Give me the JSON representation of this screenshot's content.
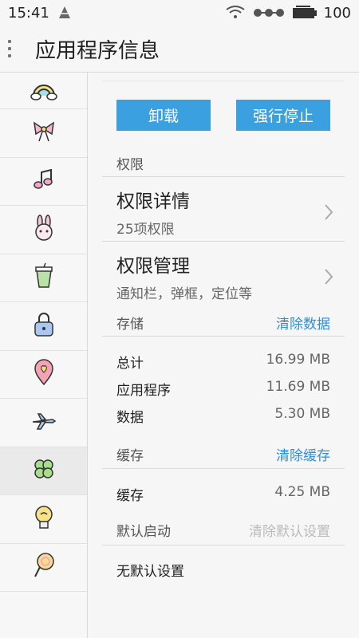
{
  "status_bar": {
    "time": "15:41",
    "battery": "100"
  },
  "header": {
    "title": "应用程序信息"
  },
  "sidebar": {
    "icons": [
      "rainbow-icon",
      "bow-icon",
      "music-note-icon",
      "bunny-icon",
      "cup-icon",
      "lock-icon",
      "location-pin-icon",
      "airplane-icon",
      "clover-icon",
      "lightbulb-icon",
      "lollipop-icon"
    ],
    "active_index": 8
  },
  "actions": {
    "uninstall": "卸载",
    "force_stop": "强行停止"
  },
  "permissions": {
    "section_label": "权限",
    "details_title": "权限详情",
    "details_sub": "25项权限",
    "manage_title": "权限管理",
    "manage_sub": "通知栏，弹框，定位等"
  },
  "storage": {
    "label": "存储",
    "clear_link": "清除数据",
    "rows": [
      {
        "label": "总计",
        "value": "16.99 MB"
      },
      {
        "label": "应用程序",
        "value": "11.69 MB"
      },
      {
        "label": "数据",
        "value": "5.30 MB"
      }
    ]
  },
  "cache": {
    "label": "缓存",
    "clear_link": "清除缓存",
    "row_label": "缓存",
    "row_value": "4.25 MB"
  },
  "default_launch": {
    "label": "默认启动",
    "clear_link": "清除默认设置",
    "status": "无默认设置"
  },
  "colors": {
    "accent": "#3aa0e0",
    "link": "#2f8fd6"
  }
}
